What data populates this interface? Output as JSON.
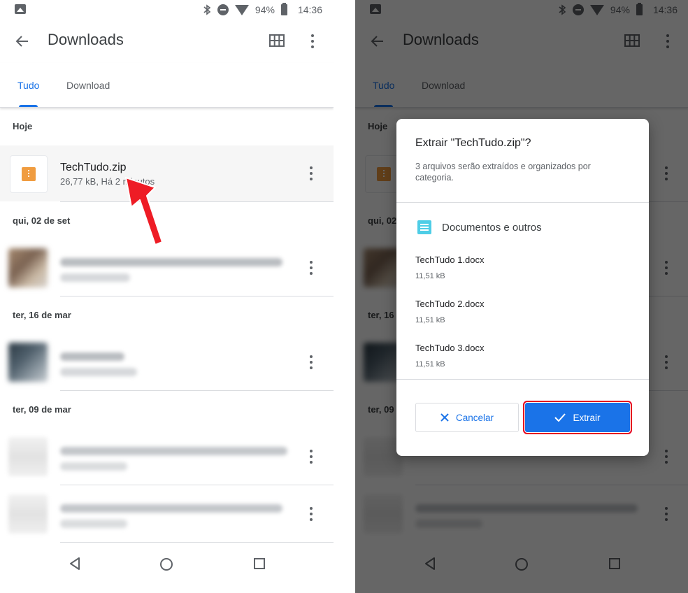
{
  "status_bar": {
    "battery": "94%",
    "time": "14:36"
  },
  "app_bar": {
    "title": "Downloads"
  },
  "tabs": [
    {
      "label": "Tudo"
    },
    {
      "label": "Download"
    }
  ],
  "sections": [
    {
      "label": "Hoje"
    },
    {
      "label": "qui, 02 de set"
    },
    {
      "label": "ter, 16 de mar"
    },
    {
      "label": "ter, 09 de mar"
    }
  ],
  "files": [
    {
      "name": "TechTudo.zip",
      "meta": "26,77 kB, Há 2 minutos",
      "icon": "zip-icon"
    }
  ],
  "dialog": {
    "title": "Extrair \"TechTudo.zip\"?",
    "description": "3 arquivos serão extraídos e organizados por categoria.",
    "category": "Documentos e outros",
    "items": [
      {
        "name": "TechTudo 1.docx",
        "size": "11,51 kB"
      },
      {
        "name": "TechTudo 2.docx",
        "size": "11,51 kB"
      },
      {
        "name": "TechTudo 3.docx",
        "size": "11,51 kB"
      }
    ],
    "cancel_label": "Cancelar",
    "extract_label": "Extrair"
  },
  "colors": {
    "accent": "#1a73e8",
    "highlight_outline": "#e5001e",
    "zip": "#f09c40",
    "doc": "#4ecde6"
  }
}
